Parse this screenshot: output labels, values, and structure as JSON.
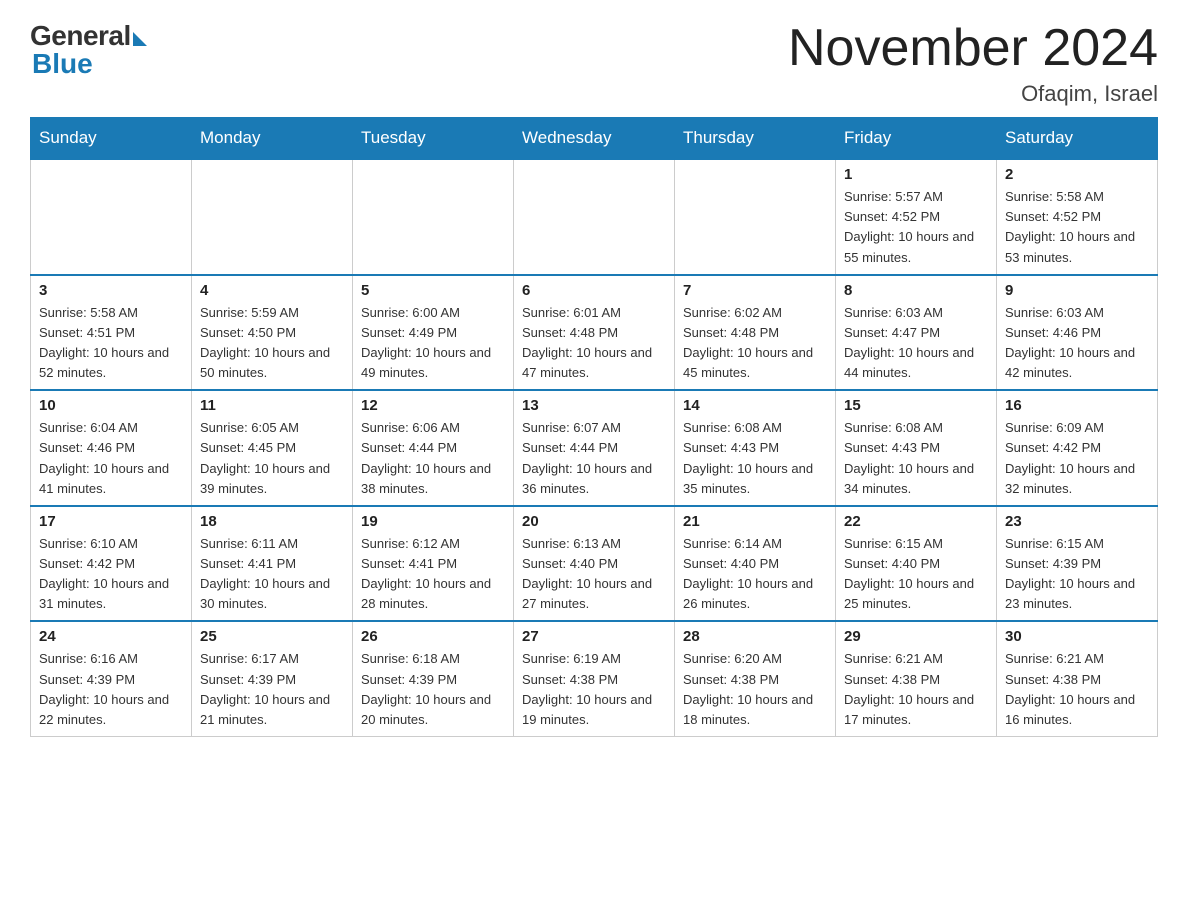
{
  "logo": {
    "general": "General",
    "blue": "Blue"
  },
  "header": {
    "title": "November 2024",
    "location": "Ofaqim, Israel"
  },
  "days_of_week": [
    "Sunday",
    "Monday",
    "Tuesday",
    "Wednesday",
    "Thursday",
    "Friday",
    "Saturday"
  ],
  "weeks": [
    [
      {
        "day": "",
        "info": ""
      },
      {
        "day": "",
        "info": ""
      },
      {
        "day": "",
        "info": ""
      },
      {
        "day": "",
        "info": ""
      },
      {
        "day": "",
        "info": ""
      },
      {
        "day": "1",
        "info": "Sunrise: 5:57 AM\nSunset: 4:52 PM\nDaylight: 10 hours and 55 minutes."
      },
      {
        "day": "2",
        "info": "Sunrise: 5:58 AM\nSunset: 4:52 PM\nDaylight: 10 hours and 53 minutes."
      }
    ],
    [
      {
        "day": "3",
        "info": "Sunrise: 5:58 AM\nSunset: 4:51 PM\nDaylight: 10 hours and 52 minutes."
      },
      {
        "day": "4",
        "info": "Sunrise: 5:59 AM\nSunset: 4:50 PM\nDaylight: 10 hours and 50 minutes."
      },
      {
        "day": "5",
        "info": "Sunrise: 6:00 AM\nSunset: 4:49 PM\nDaylight: 10 hours and 49 minutes."
      },
      {
        "day": "6",
        "info": "Sunrise: 6:01 AM\nSunset: 4:48 PM\nDaylight: 10 hours and 47 minutes."
      },
      {
        "day": "7",
        "info": "Sunrise: 6:02 AM\nSunset: 4:48 PM\nDaylight: 10 hours and 45 minutes."
      },
      {
        "day": "8",
        "info": "Sunrise: 6:03 AM\nSunset: 4:47 PM\nDaylight: 10 hours and 44 minutes."
      },
      {
        "day": "9",
        "info": "Sunrise: 6:03 AM\nSunset: 4:46 PM\nDaylight: 10 hours and 42 minutes."
      }
    ],
    [
      {
        "day": "10",
        "info": "Sunrise: 6:04 AM\nSunset: 4:46 PM\nDaylight: 10 hours and 41 minutes."
      },
      {
        "day": "11",
        "info": "Sunrise: 6:05 AM\nSunset: 4:45 PM\nDaylight: 10 hours and 39 minutes."
      },
      {
        "day": "12",
        "info": "Sunrise: 6:06 AM\nSunset: 4:44 PM\nDaylight: 10 hours and 38 minutes."
      },
      {
        "day": "13",
        "info": "Sunrise: 6:07 AM\nSunset: 4:44 PM\nDaylight: 10 hours and 36 minutes."
      },
      {
        "day": "14",
        "info": "Sunrise: 6:08 AM\nSunset: 4:43 PM\nDaylight: 10 hours and 35 minutes."
      },
      {
        "day": "15",
        "info": "Sunrise: 6:08 AM\nSunset: 4:43 PM\nDaylight: 10 hours and 34 minutes."
      },
      {
        "day": "16",
        "info": "Sunrise: 6:09 AM\nSunset: 4:42 PM\nDaylight: 10 hours and 32 minutes."
      }
    ],
    [
      {
        "day": "17",
        "info": "Sunrise: 6:10 AM\nSunset: 4:42 PM\nDaylight: 10 hours and 31 minutes."
      },
      {
        "day": "18",
        "info": "Sunrise: 6:11 AM\nSunset: 4:41 PM\nDaylight: 10 hours and 30 minutes."
      },
      {
        "day": "19",
        "info": "Sunrise: 6:12 AM\nSunset: 4:41 PM\nDaylight: 10 hours and 28 minutes."
      },
      {
        "day": "20",
        "info": "Sunrise: 6:13 AM\nSunset: 4:40 PM\nDaylight: 10 hours and 27 minutes."
      },
      {
        "day": "21",
        "info": "Sunrise: 6:14 AM\nSunset: 4:40 PM\nDaylight: 10 hours and 26 minutes."
      },
      {
        "day": "22",
        "info": "Sunrise: 6:15 AM\nSunset: 4:40 PM\nDaylight: 10 hours and 25 minutes."
      },
      {
        "day": "23",
        "info": "Sunrise: 6:15 AM\nSunset: 4:39 PM\nDaylight: 10 hours and 23 minutes."
      }
    ],
    [
      {
        "day": "24",
        "info": "Sunrise: 6:16 AM\nSunset: 4:39 PM\nDaylight: 10 hours and 22 minutes."
      },
      {
        "day": "25",
        "info": "Sunrise: 6:17 AM\nSunset: 4:39 PM\nDaylight: 10 hours and 21 minutes."
      },
      {
        "day": "26",
        "info": "Sunrise: 6:18 AM\nSunset: 4:39 PM\nDaylight: 10 hours and 20 minutes."
      },
      {
        "day": "27",
        "info": "Sunrise: 6:19 AM\nSunset: 4:38 PM\nDaylight: 10 hours and 19 minutes."
      },
      {
        "day": "28",
        "info": "Sunrise: 6:20 AM\nSunset: 4:38 PM\nDaylight: 10 hours and 18 minutes."
      },
      {
        "day": "29",
        "info": "Sunrise: 6:21 AM\nSunset: 4:38 PM\nDaylight: 10 hours and 17 minutes."
      },
      {
        "day": "30",
        "info": "Sunrise: 6:21 AM\nSunset: 4:38 PM\nDaylight: 10 hours and 16 minutes."
      }
    ]
  ]
}
